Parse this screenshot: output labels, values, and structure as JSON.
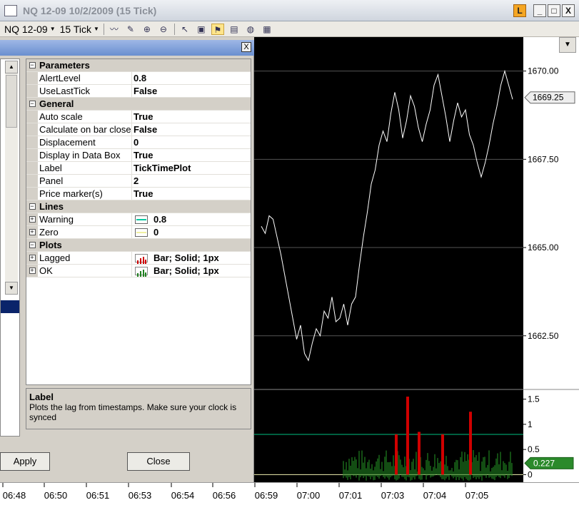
{
  "window": {
    "title": "NQ 12-09  10/2/2009 (15 Tick)",
    "buttons": [
      "L",
      "_",
      "□",
      "X"
    ]
  },
  "toolbar": {
    "instrument": "NQ 12-09",
    "interval": "15 Tick"
  },
  "dialog": {
    "close_label": "X",
    "apply_label": "Apply",
    "cancel_label": "Close",
    "rows": [
      {
        "type": "cat",
        "name": "Parameters",
        "sym": "⊟"
      },
      {
        "type": "prop",
        "name": "AlertLevel",
        "value": "0.8"
      },
      {
        "type": "prop",
        "name": "UseLastTick",
        "value": "False"
      },
      {
        "type": "cat",
        "name": "General",
        "sym": "⊟"
      },
      {
        "type": "prop",
        "name": "Auto scale",
        "value": "True"
      },
      {
        "type": "prop",
        "name": "Calculate on bar close",
        "value": "False"
      },
      {
        "type": "prop",
        "name": "Displacement",
        "value": "0"
      },
      {
        "type": "prop",
        "name": "Display in Data Box",
        "value": "True"
      },
      {
        "type": "prop",
        "name": "Label",
        "value": "TickTimePlot"
      },
      {
        "type": "prop",
        "name": "Panel",
        "value": "2"
      },
      {
        "type": "prop",
        "name": "Price marker(s)",
        "value": "True"
      },
      {
        "type": "cat",
        "name": "Lines",
        "sym": "⊟"
      },
      {
        "type": "prop",
        "name": "Warning",
        "value": "0.8",
        "swatch": "#00c8a0",
        "expand": "⊞"
      },
      {
        "type": "prop",
        "name": "Zero",
        "value": "0",
        "swatch": "#f0f0a0",
        "expand": "⊞"
      },
      {
        "type": "cat",
        "name": "Plots",
        "sym": "⊟"
      },
      {
        "type": "prop",
        "name": "Lagged",
        "value": "Bar; Solid; 1px",
        "bars": "#d00000",
        "expand": "⊞"
      },
      {
        "type": "prop",
        "name": "OK",
        "value": "Bar; Solid; 1px",
        "bars": "#208020",
        "expand": "⊞"
      }
    ],
    "description": {
      "title": "Label",
      "text": "Plots the lag from timestamps. Make sure your clock is synced"
    }
  },
  "chart_data": [
    {
      "type": "line",
      "price_ticks": [
        "1670.00",
        "1667.50",
        "1665.00",
        "1662.50"
      ],
      "ylim": [
        1661.0,
        1670.8
      ],
      "last_price": "1669.25",
      "y": [
        1665.6,
        1665.4,
        1665.9,
        1665.8,
        1665.3,
        1664.8,
        1664.2,
        1663.6,
        1663.0,
        1662.4,
        1662.8,
        1662.0,
        1661.8,
        1662.3,
        1662.7,
        1662.5,
        1663.2,
        1663.0,
        1663.6,
        1662.9,
        1663.0,
        1663.4,
        1662.8,
        1663.4,
        1663.6,
        1664.5,
        1665.3,
        1666.0,
        1666.8,
        1667.2,
        1667.9,
        1668.3,
        1668.0,
        1668.8,
        1669.4,
        1668.9,
        1668.1,
        1668.6,
        1669.3,
        1669.0,
        1668.4,
        1668.0,
        1668.5,
        1668.9,
        1669.6,
        1669.9,
        1669.3,
        1668.7,
        1668.0,
        1668.6,
        1669.1,
        1668.7,
        1668.9,
        1668.2,
        1667.9,
        1667.4,
        1667.0,
        1667.4,
        1667.9,
        1668.5,
        1669.0,
        1669.6,
        1670.0,
        1669.6,
        1669.2
      ]
    },
    {
      "type": "bar",
      "ticks": [
        "1.5",
        "1",
        "0.5",
        "0"
      ],
      "ylim": [
        -0.15,
        1.65
      ],
      "warning_level": 0.8,
      "last_value": "0.227",
      "series": [
        {
          "name": "Lagged",
          "color": "#d00000"
        },
        {
          "name": "OK",
          "color": "#208020"
        }
      ]
    }
  ],
  "time_axis": [
    "06:48",
    "06:50",
    "06:51",
    "06:53",
    "06:54",
    "06:56",
    "06:59",
    "07:00",
    "07:01",
    "07:03",
    "07:04",
    "07:05"
  ]
}
